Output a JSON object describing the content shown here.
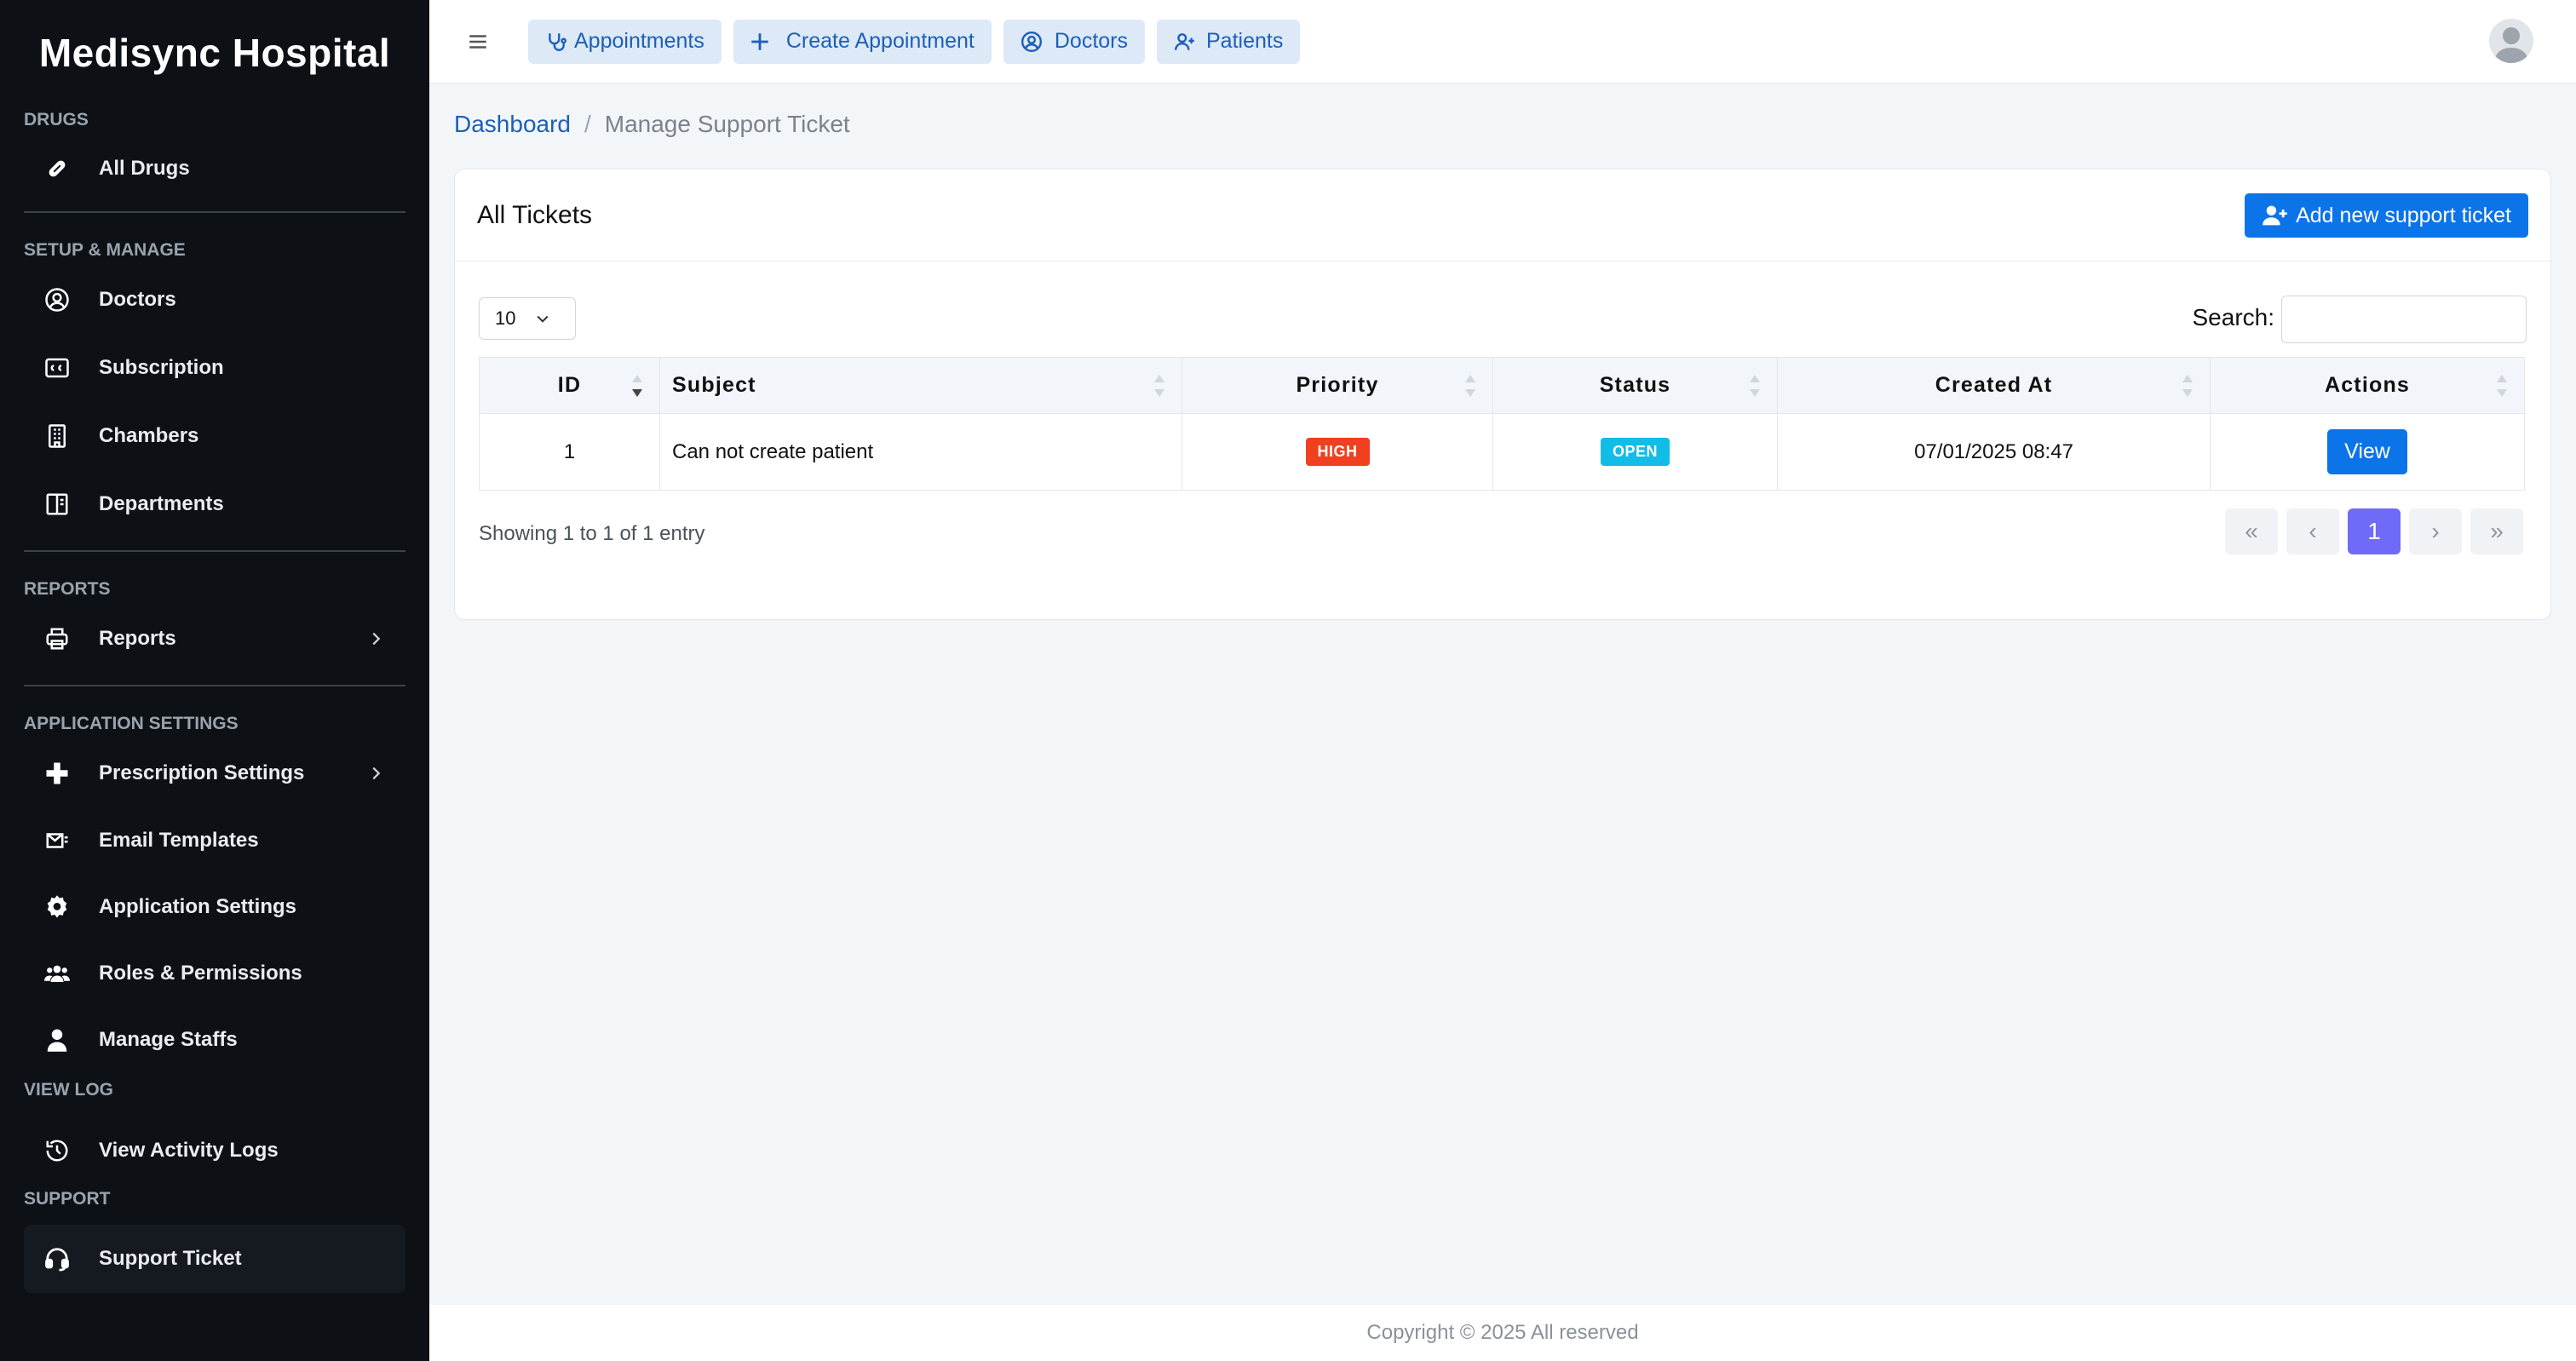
{
  "brand": "Medisync Hospital",
  "sidebar": {
    "sections": [
      {
        "title": "Drugs",
        "items": [
          {
            "label": "All Drugs",
            "icon": "pill-icon"
          }
        ]
      },
      {
        "title": "Setup & Manage",
        "items": [
          {
            "label": "Doctors",
            "icon": "user-circle-icon"
          },
          {
            "label": "Subscription",
            "icon": "id-card-icon"
          },
          {
            "label": "Chambers",
            "icon": "building-icon"
          },
          {
            "label": "Departments",
            "icon": "columns-icon"
          }
        ]
      },
      {
        "title": "Reports",
        "items": [
          {
            "label": "Reports",
            "icon": "printer-icon"
          }
        ]
      },
      {
        "title": "Application Settings",
        "items": [
          {
            "label": "Prescription Settings",
            "icon": "plus-icon"
          },
          {
            "label": "Email Templates",
            "icon": "envelope-icon"
          },
          {
            "label": "Application Settings",
            "icon": "gear-icon"
          },
          {
            "label": "Roles & Permissions",
            "icon": "users-icon"
          },
          {
            "label": "Manage Staffs",
            "icon": "user-icon"
          }
        ]
      },
      {
        "title": "View Log",
        "items": [
          {
            "label": "View Activity Logs",
            "icon": "history-icon"
          }
        ]
      },
      {
        "title": "Support",
        "items": [
          {
            "label": "Support Ticket",
            "icon": "headset-icon"
          }
        ]
      }
    ]
  },
  "topbar": {
    "buttons": [
      {
        "label": "Appointments",
        "icon": "stethoscope-icon"
      },
      {
        "label": "Create Appointment",
        "icon": "plus-icon"
      },
      {
        "label": "Doctors",
        "icon": "user-circle-icon"
      },
      {
        "label": "Patients",
        "icon": "user-plus-icon"
      }
    ]
  },
  "breadcrumb": {
    "home": "Dashboard",
    "separator": "/",
    "current": "Manage Support Ticket"
  },
  "card": {
    "title": "All Tickets",
    "add_button": "Add new support ticket",
    "page_length": "10",
    "search_label": "Search:",
    "columns": [
      "ID",
      "Subject",
      "Priority",
      "Status",
      "Created At",
      "Actions"
    ],
    "rows": [
      {
        "id": "1",
        "subject": "Can not create patient",
        "priority": "HIGH",
        "status": "OPEN",
        "created_at": "07/01/2025 08:47",
        "action": "View"
      }
    ],
    "showing": "Showing 1 to 1 of 1 entry",
    "pager": {
      "first": "«",
      "prev": "‹",
      "current": "1",
      "next": "›",
      "last": "»"
    }
  },
  "colors": {
    "priority_high": "#f0401f",
    "status_open": "#11bde6",
    "accent": "#0b74e8"
  },
  "footer": "Copyright © 2025 All reserved"
}
